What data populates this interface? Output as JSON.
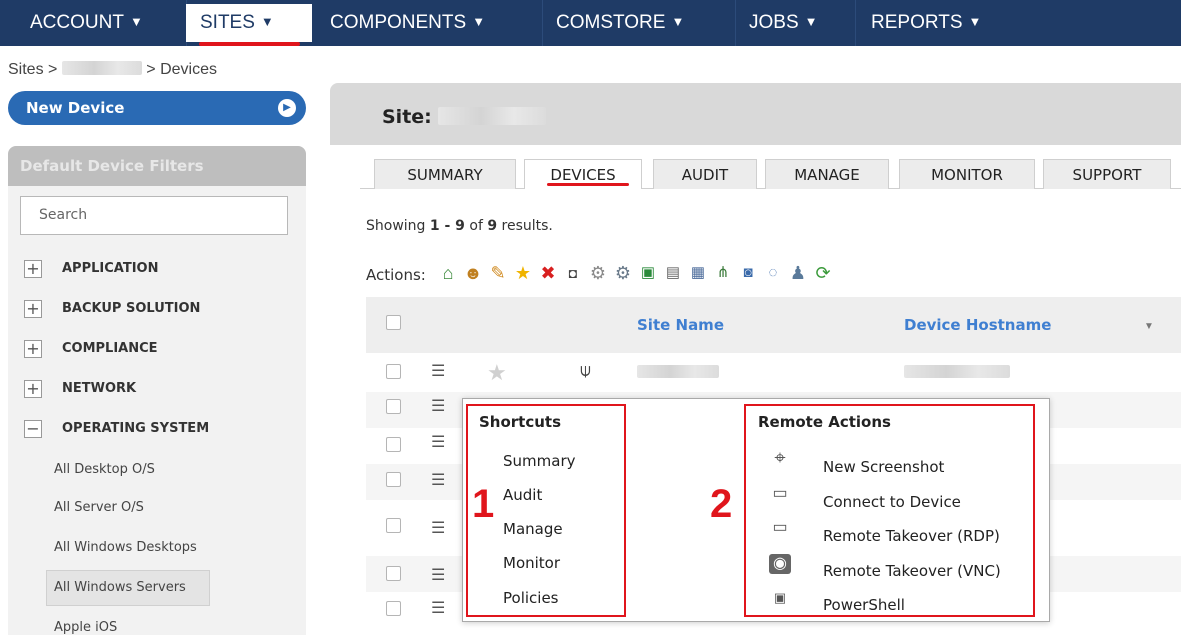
{
  "nav": {
    "items": [
      {
        "label": "ACCOUNT"
      },
      {
        "label": "SITES"
      },
      {
        "label": "COMPONENTS"
      },
      {
        "label": "COMSTORE"
      },
      {
        "label": "JOBS"
      },
      {
        "label": "REPORTS"
      }
    ],
    "caret": "▼",
    "active_index": 1,
    "colors": {
      "bar": "#1f3b66",
      "highlight": "#e0151c"
    }
  },
  "breadcrumb": {
    "root": "Sites",
    "sep": ">",
    "current": "> Devices"
  },
  "sidebar": {
    "new_device_label": "New Device",
    "filters_title": "Default Device Filters",
    "search_placeholder": "Search",
    "groups": [
      {
        "label": "APPLICATION",
        "toggle": "+"
      },
      {
        "label": "BACKUP SOLUTION",
        "toggle": "+"
      },
      {
        "label": "COMPLIANCE",
        "toggle": "+"
      },
      {
        "label": "NETWORK",
        "toggle": "+"
      },
      {
        "label": "OPERATING SYSTEM",
        "toggle": "−"
      }
    ],
    "os_items": [
      {
        "label": "All Desktop O/S"
      },
      {
        "label": "All Server O/S"
      },
      {
        "label": "All Windows Desktops"
      },
      {
        "label": "All Windows Servers",
        "selected": true
      },
      {
        "label": "Apple iOS"
      }
    ]
  },
  "main": {
    "site_label": "Site:",
    "tabs": [
      {
        "label": "SUMMARY"
      },
      {
        "label": "DEVICES",
        "active": true
      },
      {
        "label": "AUDIT"
      },
      {
        "label": "MANAGE"
      },
      {
        "label": "MONITOR"
      },
      {
        "label": "SUPPORT"
      }
    ],
    "showing": {
      "prefix": "Showing ",
      "range": "1 - 9",
      "mid": " of ",
      "total": "9",
      "suffix": " results."
    },
    "actions_label": "Actions:",
    "action_icons": [
      "home-icon",
      "users-icon",
      "pencil-icon",
      "star-icon",
      "delete-icon",
      "binoculars-icon",
      "gear-icon",
      "gears-icon",
      "spreadsheet-icon",
      "server-icon",
      "computer-icon",
      "network-icon",
      "monitor-icon",
      "chat-icon",
      "user-key-icon",
      "refresh-icon"
    ],
    "columns": {
      "site_name": "Site Name",
      "device_hostname": "Device Hostname"
    }
  },
  "popup": {
    "shortcuts_title": "Shortcuts",
    "shortcuts": [
      "Summary",
      "Audit",
      "Manage",
      "Monitor",
      "Policies"
    ],
    "remote_title": "Remote Actions",
    "remote_actions": [
      {
        "label": "New Screenshot",
        "icon": "crosshair-icon"
      },
      {
        "label": "Connect to Device",
        "icon": "monitor-connect-icon"
      },
      {
        "label": "Remote Takeover (RDP)",
        "icon": "rdp-icon"
      },
      {
        "label": "Remote Takeover (VNC)",
        "icon": "vnc-eye-icon"
      },
      {
        "label": "PowerShell",
        "icon": "powershell-icon"
      }
    ],
    "callout_1": "1",
    "callout_2": "2"
  }
}
